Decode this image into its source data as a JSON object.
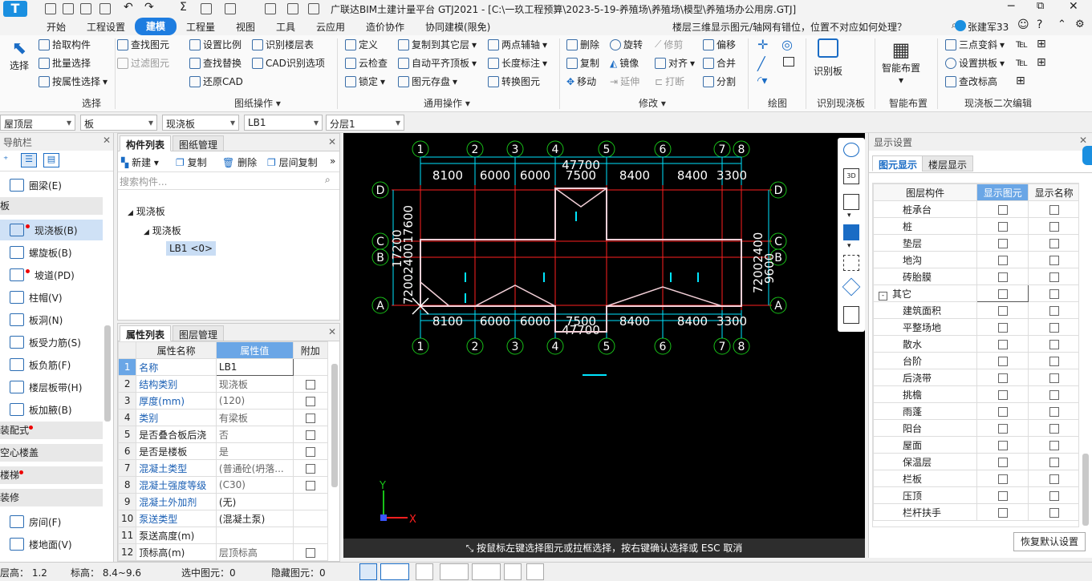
{
  "title": {
    "text": "广联达BIM土建计量平台 GTJ2021 - [C:\\一玖工程预算\\2023-5-19-养殖场\\养殖场\\模型\\养殖场办公用房.GTJ]",
    "search": "楼层三维显示图元/轴网有错位，位置不对应如何处理？",
    "user": "张建军33"
  },
  "menu": [
    "开始",
    "工程设置",
    "建模",
    "工程量",
    "视图",
    "工具",
    "云应用",
    "造价协作",
    "协同建模(限免)"
  ],
  "ribbon": {
    "select": {
      "label": "选择",
      "items": [
        "拾取构件",
        "批量选择",
        "按属性选择"
      ],
      "group": "选择"
    },
    "drawing": {
      "items": [
        "查找图元",
        "过滤图元",
        "设置比例",
        "查找替换",
        "还原CAD",
        "识别楼层表",
        "CAD识别选项"
      ],
      "group": "图纸操作"
    },
    "general": {
      "items": [
        "定义",
        "云检查",
        "锁定",
        "复制到其它层",
        "自动平齐顶板",
        "图元存盘",
        "两点辅轴",
        "长度标注",
        "转换图元"
      ],
      "group": "通用操作"
    },
    "modify": {
      "items": [
        "删除",
        "旋转",
        "修剪",
        "偏移",
        "复制",
        "镜像",
        "对齐",
        "合并",
        "移动",
        "延伸",
        "打断",
        "分割"
      ],
      "group": "修改"
    },
    "draw": {
      "group": "绘图"
    },
    "identify": {
      "label": "识别板",
      "group": "识别现浇板"
    },
    "smart": {
      "label": "智能布置",
      "group": "智能布置"
    },
    "edit2": {
      "items": [
        "三点变斜",
        "设置拱板",
        "查改标高"
      ],
      "group": "现浇板二次编辑"
    }
  },
  "selectors": [
    "屋顶层",
    "板",
    "现浇板",
    "LB1",
    "分层1"
  ],
  "nav": {
    "title": "导航栏",
    "rows": [
      {
        "label": "圈梁(E)",
        "type": "item"
      },
      {
        "label": "板",
        "type": "cat"
      },
      {
        "label": "现浇板(B)",
        "type": "item",
        "active": true,
        "dot": true
      },
      {
        "label": "螺旋板(B)",
        "type": "item"
      },
      {
        "label": "坡道(PD)",
        "type": "item",
        "dot": true
      },
      {
        "label": "柱帽(V)",
        "type": "item"
      },
      {
        "label": "板洞(N)",
        "type": "item"
      },
      {
        "label": "板受力筋(S)",
        "type": "item"
      },
      {
        "label": "板负筋(F)",
        "type": "item"
      },
      {
        "label": "楼层板带(H)",
        "type": "item"
      },
      {
        "label": "板加腋(B)",
        "type": "item"
      },
      {
        "label": "装配式",
        "type": "cat",
        "dot": true
      },
      {
        "label": "空心楼盖",
        "type": "cat"
      },
      {
        "label": "楼梯",
        "type": "cat",
        "dot": true
      },
      {
        "label": "装修",
        "type": "cat"
      },
      {
        "label": "房间(F)",
        "type": "item"
      },
      {
        "label": "楼地面(V)",
        "type": "item"
      }
    ]
  },
  "comp_panel": {
    "tabs": [
      "构件列表",
      "图纸管理"
    ],
    "actions": [
      "新建",
      "复制",
      "删除",
      "层间复制"
    ],
    "search_placeholder": "搜索构件...",
    "tree": [
      "现浇板",
      "现浇板",
      "LB1 <0>"
    ]
  },
  "prop_panel": {
    "tabs": [
      "属性列表",
      "图层管理"
    ],
    "headers": [
      "属性名称",
      "属性值",
      "附加"
    ],
    "rows": [
      {
        "no": "1",
        "name": "名称",
        "value": "LB1",
        "check": false
      },
      {
        "no": "2",
        "name": "结构类别",
        "value": "现浇板",
        "check": true
      },
      {
        "no": "3",
        "name": "厚度(mm)",
        "value": "(120)",
        "check": true
      },
      {
        "no": "4",
        "name": "类别",
        "value": "有梁板",
        "check": true
      },
      {
        "no": "5",
        "name": "是否叠合板后浇",
        "value": "否",
        "check": true
      },
      {
        "no": "6",
        "name": "是否是楼板",
        "value": "是",
        "check": true
      },
      {
        "no": "7",
        "name": "混凝土类型",
        "value": "(普通砼(坍落...",
        "check": true
      },
      {
        "no": "8",
        "name": "混凝土强度等级",
        "value": "(C30)",
        "check": true
      },
      {
        "no": "9",
        "name": "混凝土外加剂",
        "value": "(无)",
        "check": false
      },
      {
        "no": "10",
        "name": "泵送类型",
        "value": "(混凝土泵)",
        "check": false
      },
      {
        "no": "11",
        "name": "泵送高度(m)",
        "value": "",
        "check": false
      },
      {
        "no": "12",
        "name": "顶标高(m)",
        "value": "层顶标高",
        "check": true
      }
    ]
  },
  "canvas": {
    "top_dims": [
      "8100",
      "6000",
      "6000",
      "7500",
      "8400",
      "8400",
      "3300"
    ],
    "bottom_dims": [
      "8100",
      "6000",
      "6000",
      "7500",
      "8400",
      "8400",
      "3300"
    ],
    "total": "47700",
    "axes_x": [
      "1",
      "2",
      "3",
      "4",
      "5",
      "6",
      "7",
      "8"
    ],
    "axes_y": [
      "D",
      "C",
      "B",
      "A"
    ],
    "left_dims": "7200240017600",
    "left_dims2": "17200",
    "right_dims": "72002400",
    "right_dims2": "9600",
    "hint": "按鼠标左键选择图元或拉框选择，按右键确认选择或 ESC 取消",
    "axis_x_label": "X",
    "axis_y_label": "Y"
  },
  "display_panel": {
    "title": "显示设置",
    "tabs": [
      "图元显示",
      "楼层显示"
    ],
    "headers": [
      "图层构件",
      "显示图元",
      "显示名称"
    ],
    "rows": [
      "桩承台",
      "桩",
      "垫层",
      "地沟",
      "砖胎膜",
      "其它",
      "建筑面积",
      "平整场地",
      "散水",
      "台阶",
      "后浇带",
      "挑檐",
      "雨蓬",
      "阳台",
      "屋面",
      "保温层",
      "栏板",
      "压顶",
      "栏杆扶手"
    ],
    "restore": "恢复默认设置"
  },
  "status": {
    "floor_h": "层高： 1.2",
    "elev": "标高： 8.4~9.6",
    "selected": "选中图元：0",
    "hidden": "隐藏图元：0"
  },
  "colors": {
    "accent": "#2a7dd1",
    "grid_red": "#ff2020",
    "cyan": "#00e5ff",
    "green": "#18c018"
  }
}
